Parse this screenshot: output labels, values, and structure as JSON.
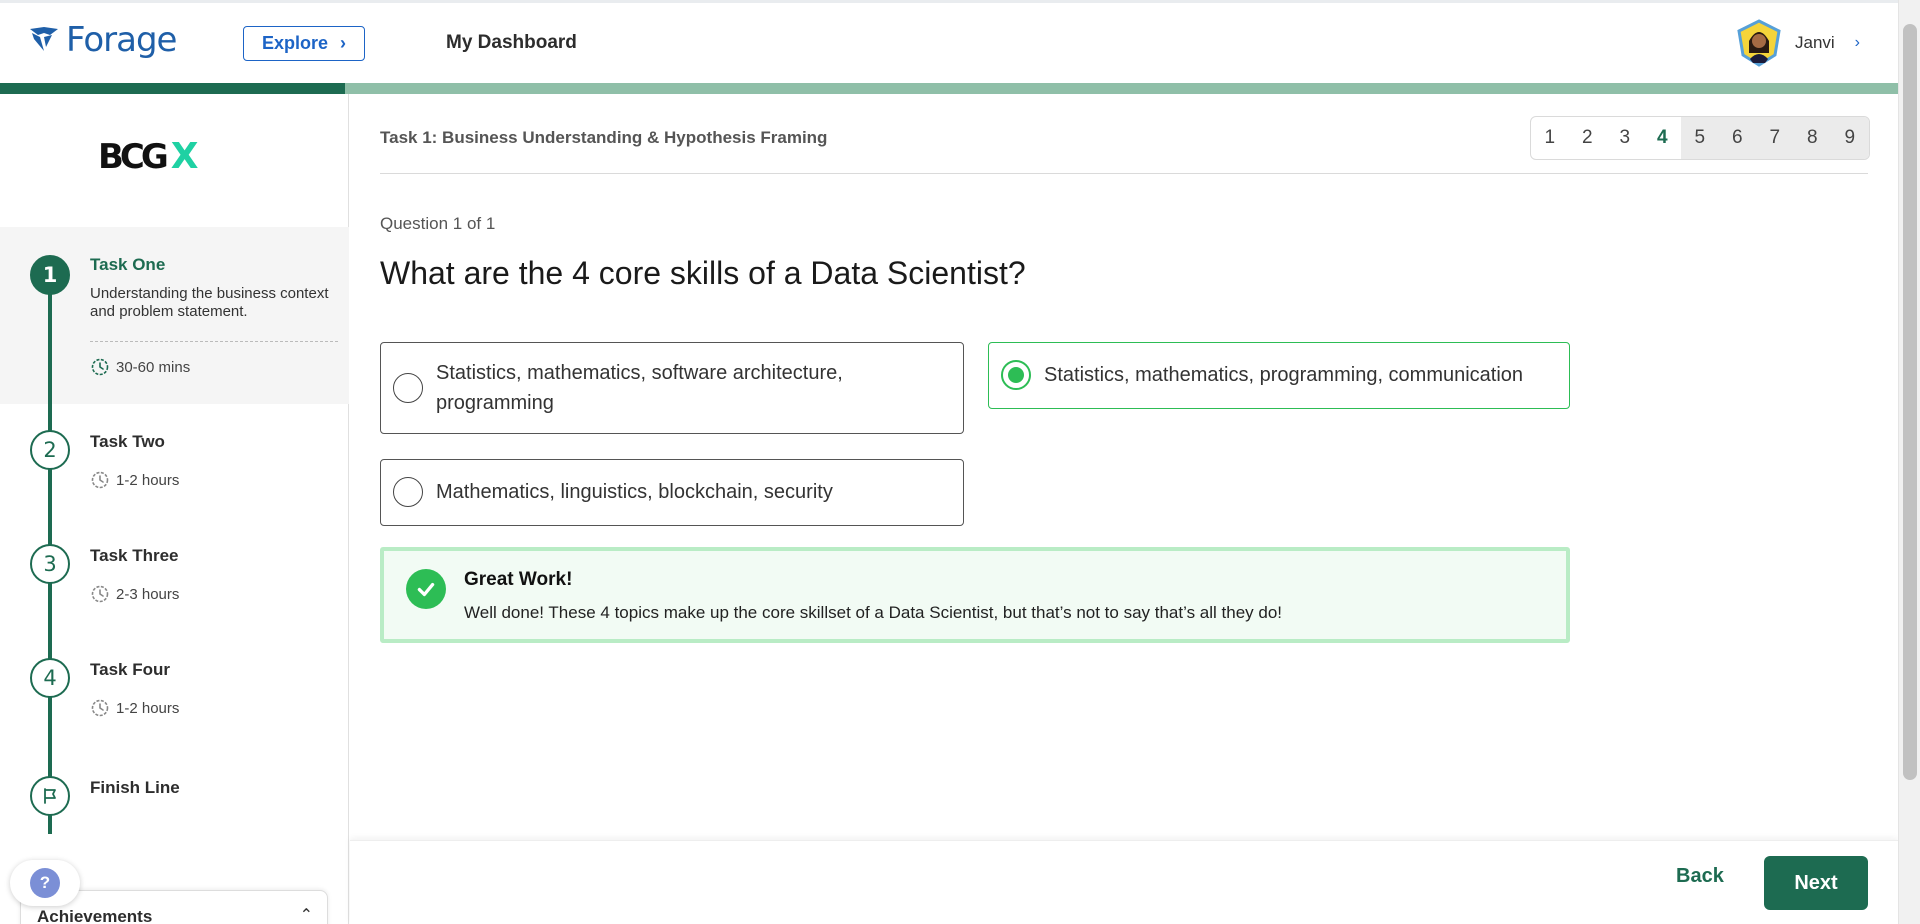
{
  "header": {
    "logo_text": "Forage",
    "explore_label": "Explore",
    "dashboard_label": "My Dashboard",
    "user_name": "Janvi",
    "progress_fraction": 0.182
  },
  "sidebar": {
    "company_logo": {
      "main": "BCG",
      "accent": "X"
    },
    "tasks": [
      {
        "number": "1",
        "title": "Task One",
        "description": "Understanding the business context and problem statement.",
        "duration": "30-60 mins",
        "active": true
      },
      {
        "number": "2",
        "title": "Task Two",
        "duration": "1-2 hours"
      },
      {
        "number": "3",
        "title": "Task Three",
        "duration": "2-3 hours"
      },
      {
        "number": "4",
        "title": "Task Four",
        "duration": "1-2 hours"
      },
      {
        "title": "Finish Line",
        "icon": "flag-icon"
      }
    ],
    "help_label": "?",
    "achievements_label": "Achievements"
  },
  "main": {
    "task_heading": "Task 1: Business Understanding & Hypothesis Framing",
    "pages": [
      "1",
      "2",
      "3",
      "4",
      "5",
      "6",
      "7",
      "8",
      "9"
    ],
    "current_page": "4",
    "question_counter": "Question 1 of 1",
    "question": "What are the 4 core skills of a Data Scientist?",
    "options": [
      {
        "text": "Statistics, mathematics, software architecture, programming",
        "selected": false
      },
      {
        "text": "Statistics, mathematics, programming, communication",
        "selected": true
      },
      {
        "text": "Mathematics, linguistics, blockchain, security",
        "selected": false
      }
    ],
    "feedback": {
      "title": "Great Work!",
      "body": "Well done! These 4 topics make up the core skillset of a Data Scientist, but that’s not to say that’s all they do!"
    }
  },
  "footer": {
    "back_label": "Back",
    "next_label": "Next"
  },
  "colors": {
    "brand_blue": "#1f5fa8",
    "primary_green": "#1d6b51",
    "success_green": "#2dbd55",
    "progress_track": "#8fbfa8",
    "accent_teal": "#1fd1a3"
  }
}
